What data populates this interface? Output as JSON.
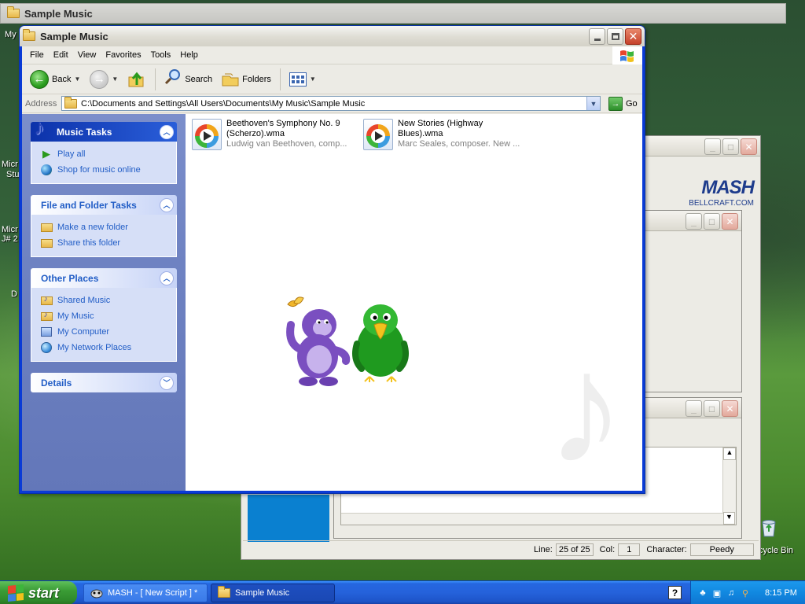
{
  "desktop": {
    "top_window_title": "Sample Music",
    "icon_labels": [
      "My",
      "Micr",
      "Stu",
      "Micr",
      "J# 2",
      "D",
      "cycle Bin"
    ]
  },
  "main_window": {
    "title": "Sample Music",
    "menu": [
      "File",
      "Edit",
      "View",
      "Favorites",
      "Tools",
      "Help"
    ],
    "toolbar": {
      "back": "Back",
      "search": "Search",
      "folders": "Folders"
    },
    "address": {
      "label": "Address",
      "path": "C:\\Documents and Settings\\All Users\\Documents\\My Music\\Sample Music",
      "go": "Go"
    },
    "task_pane": {
      "music_tasks": {
        "title": "Music Tasks",
        "items": [
          "Play all",
          "Shop for music online"
        ]
      },
      "file_folder_tasks": {
        "title": "File and Folder Tasks",
        "items": [
          "Make a new folder",
          "Share this folder"
        ]
      },
      "other_places": {
        "title": "Other Places",
        "items": [
          "Shared Music",
          "My Music",
          "My Computer",
          "My Network Places"
        ]
      },
      "details": {
        "title": "Details"
      }
    },
    "files": [
      {
        "name_line1": "Beethoven's Symphony No. 9",
        "name_line2": "(Scherzo).wma",
        "meta": "Ludwig van Beethoven, comp..."
      },
      {
        "name_line1": "New Stories (Highway",
        "name_line2": "Blues).wma",
        "meta": "Marc Seales, composer. New ..."
      }
    ]
  },
  "bg_windows": {
    "mash_logo": "MASH",
    "mash_site": "BELLCRAFT.COM",
    "status": {
      "line_label": "Line:",
      "line_value": "25 of 25",
      "col_label": "Col:",
      "col_value": "1",
      "character_label": "Character:",
      "character_value": "Peedy"
    }
  },
  "taskbar": {
    "start": "start",
    "tasks": [
      {
        "label": "MASH - [ New Script ] *",
        "active": false
      },
      {
        "label": "Sample Music",
        "active": true
      }
    ],
    "clock": "8:15 PM"
  },
  "colors": {
    "xp_blue": "#0a3bd6",
    "task_link": "#215dc6",
    "start_green": "#3a9c35"
  }
}
